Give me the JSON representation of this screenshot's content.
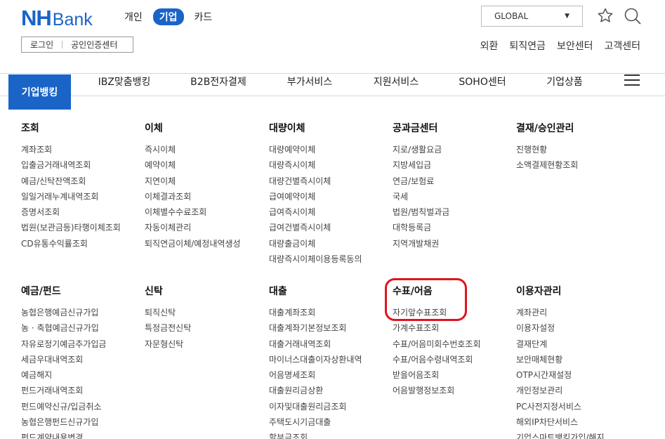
{
  "brand": {
    "nh": "NH",
    "bank": "Bank"
  },
  "segments": [
    {
      "label": "개인",
      "active": false
    },
    {
      "label": "기업",
      "active": true
    },
    {
      "label": "카드",
      "active": false
    }
  ],
  "login": {
    "login_label": "로그인",
    "cert_label": "공인인증센터"
  },
  "global_select": {
    "value": "GLOBAL"
  },
  "util_links": [
    "외환",
    "퇴직연금",
    "보안센터",
    "고객센터"
  ],
  "gnb": {
    "active": "기업뱅킹",
    "items": [
      "IBZ맞춤뱅킹",
      "B2B전자결제",
      "부가서비스",
      "지원서비스",
      "SOHO센터",
      "기업상품"
    ]
  },
  "icons": {
    "favorite": "star-icon",
    "search": "search-icon",
    "menu": "hamburger-menu-icon",
    "select": "caret-down-icon"
  },
  "menu": {
    "row1": [
      {
        "title": "조회",
        "items": [
          "계좌조회",
          "입출금거래내역조회",
          "예금/신탁잔액조회",
          "일일거래누계내역조회",
          "증명서조회",
          "법원(보관금등)타행이체조회",
          "CD유통수익률조회"
        ]
      },
      {
        "title": "이체",
        "items": [
          "즉시이체",
          "예약이체",
          "지연이체",
          "이체결과조회",
          "이체별수수료조회",
          "자동이체관리",
          "퇴직연금이체/예정내역생성"
        ]
      },
      {
        "title": "대량이체",
        "items": [
          "대량예약이체",
          "대량즉시이체",
          "대량건별즉시이체",
          "급여예약이체",
          "급여즉시이체",
          "급여건별즉시이체",
          "대량출금이체",
          "대량즉시이체이용등록동의"
        ]
      },
      {
        "title": "공과금센터",
        "items": [
          "지로/생활요금",
          "지방세입금",
          "연금/보험료",
          "국세",
          "법원/범칙벌과금",
          "대학등록금",
          "지역개발채권"
        ]
      },
      {
        "title": "결재/승인관리",
        "items": [
          "진행현황",
          "소액결제현황조회"
        ]
      }
    ],
    "row2": [
      {
        "title": "예금/펀드",
        "items": [
          "농협은행예금신규가입",
          "농 · 축협예금신규가입",
          "자유로정기예금추가입금",
          "세금우대내역조회",
          "예금해지",
          "펀드거래내역조회",
          "펀드예약신규/입금취소",
          "농협은행펀드신규가입",
          "펀드계약내용변경"
        ]
      },
      {
        "title": "신탁",
        "items": [
          "퇴직신탁",
          "특정금전신탁",
          "자문형신탁"
        ]
      },
      {
        "title": "대출",
        "items": [
          "대출계좌조회",
          "대출계좌기본정보조회",
          "대출거래내역조회",
          "마이너스대출이자상환내역",
          "어음명세조회",
          "대출원리금상환",
          "이자및대출원리금조회",
          "주택도시기금대출",
          "할부금조회"
        ]
      },
      {
        "title": "수표/어음",
        "items": [
          "자기앞수표조회",
          "가계수표조회",
          "수표/어음미회수번호조회",
          "수표/어음수령내역조회",
          "받을어음조회",
          "어음발행정보조회"
        ]
      },
      {
        "title": "이용자관리",
        "items": [
          "계좌관리",
          "이용자설정",
          "결재단계",
          "보안매체현황",
          "OTP시간재설정",
          "개인정보관리",
          "PC사전지정서비스",
          "해외IP차단서비스",
          "기업스마트뱅킹가입/해지"
        ]
      }
    ]
  },
  "highlight_color": "#e0141e",
  "accent": "#1a64c8"
}
